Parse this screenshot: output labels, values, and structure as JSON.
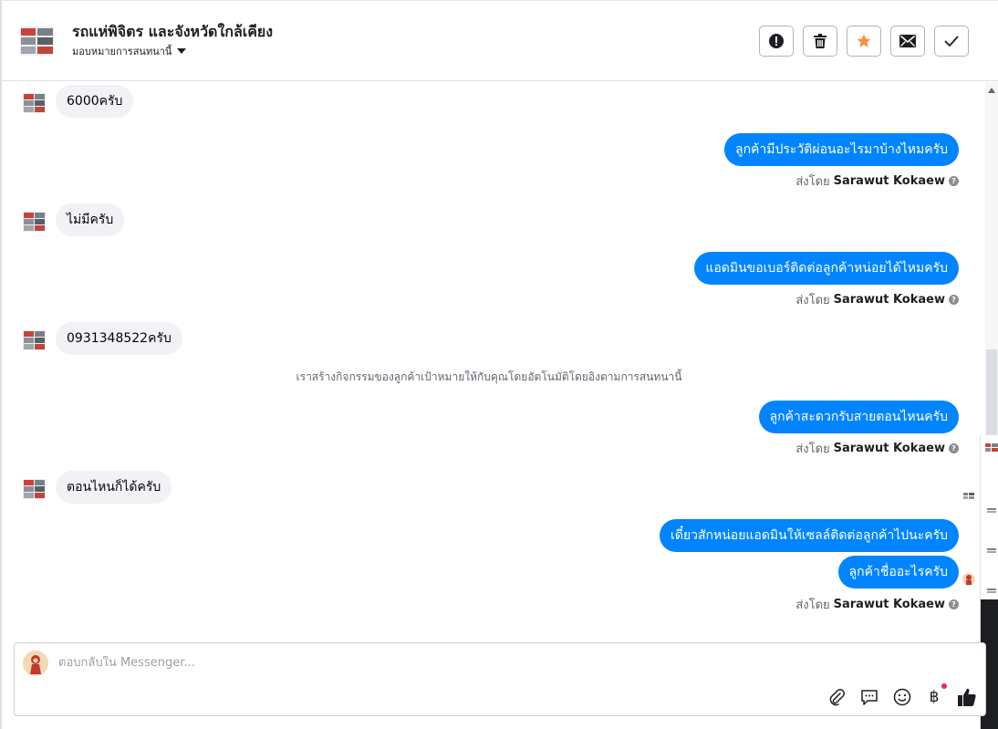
{
  "header": {
    "title": "รถแห่พิจิตร และจังหวัดใกล้เคียง",
    "assign_label": "มอบหมายการสนทนานี้"
  },
  "thread": {
    "messages": [
      {
        "direction": "in",
        "text": "6000ครับ"
      },
      {
        "direction": "out",
        "text": "ลูกค้ามีประวัติผ่อนอะไรมาบ้างไหมครับ"
      },
      {
        "direction": "in",
        "text": "ไม่มีครับ"
      },
      {
        "direction": "out",
        "text": "แอดมินขอเบอร์ติดต่อลูกค้าหน่อยได้ไหมครับ"
      },
      {
        "direction": "in",
        "text": "0931348522ครับ"
      },
      {
        "direction": "out",
        "text": "ลูกค้าสะดวกรับสายตอนไหนครับ"
      },
      {
        "direction": "in",
        "text": "ตอนไหนก็ได้ครับ"
      },
      {
        "direction": "out",
        "text": "เดี๋ยวสักหน่อยแอดมินให้เซลล์ติดต่อลูกค้าไปนะครับ"
      },
      {
        "direction": "out",
        "text": "ลูกค้าชื่ออะไรครับ"
      }
    ],
    "sent_by_prefix": "ส่งโดย",
    "sent_by_name": "Sarawut Kokaew",
    "help_glyph": "?",
    "system_note": "เราสร้างกิจกรรมของลูกค้าเป้าหมายให้กับคุณโดยอัตโนมัติโดยอิงตามการสนทนานี้"
  },
  "composer": {
    "placeholder": "ตอบกลับใน Messenger...",
    "currency_glyph": "฿"
  },
  "colors": {
    "outgoing_bubble": "#0084ff",
    "incoming_bubble": "#f0f2f5",
    "star": "#f7923a",
    "notification_dot": "#f02849"
  },
  "icons": {
    "header_actions": [
      "alert-icon",
      "trash-icon",
      "star-icon",
      "mail-icon",
      "check-icon"
    ],
    "composer_tools": [
      "attachment-icon",
      "saved-reply-icon",
      "emoji-icon",
      "payment-icon",
      "like-icon"
    ]
  }
}
